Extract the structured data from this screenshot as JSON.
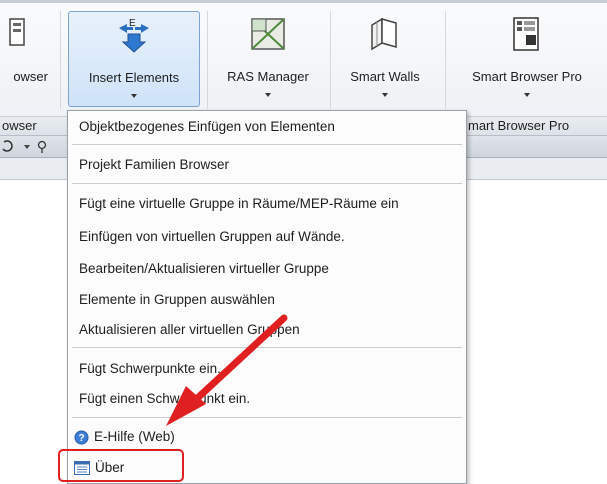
{
  "ribbon": {
    "buttons": [
      {
        "label": "owser",
        "icon": "partial-icon"
      },
      {
        "label": "Insert Elements",
        "icon": "insert-elements-icon"
      },
      {
        "label": "RAS Manager",
        "icon": "ras-manager-icon"
      },
      {
        "label": "Smart Walls",
        "icon": "smart-walls-icon"
      },
      {
        "label": "Smart Browser Pro",
        "icon": "smart-browser-pro-icon"
      }
    ],
    "panels": [
      "owser",
      "mart Browser Pro"
    ]
  },
  "menu": {
    "items": [
      {
        "label": "Objektbezogenes Einfügen von Elementen"
      },
      {
        "label": "Projekt Familien Browser"
      },
      {
        "label": "Fügt eine virtuelle Gruppe in Räume/MEP-Räume ein"
      },
      {
        "label": "Einfügen von virtuellen Gruppen auf Wände."
      },
      {
        "label": "Bearbeiten/Aktualisieren virtueller Gruppe"
      },
      {
        "label": "Elemente in Gruppen auswählen"
      },
      {
        "label": "Aktualisieren aller virtuellen Gruppen"
      },
      {
        "label": "Fügt Schwerpunkte ein."
      },
      {
        "label": "Fügt einen Schwerpunkt ein."
      },
      {
        "label": "E-Hilfe (Web)",
        "icon": "help-icon"
      },
      {
        "label": "Über",
        "icon": "info-list-icon"
      }
    ]
  },
  "colors": {
    "annotation": "#e02020",
    "highlight": "#cfe3f8"
  }
}
